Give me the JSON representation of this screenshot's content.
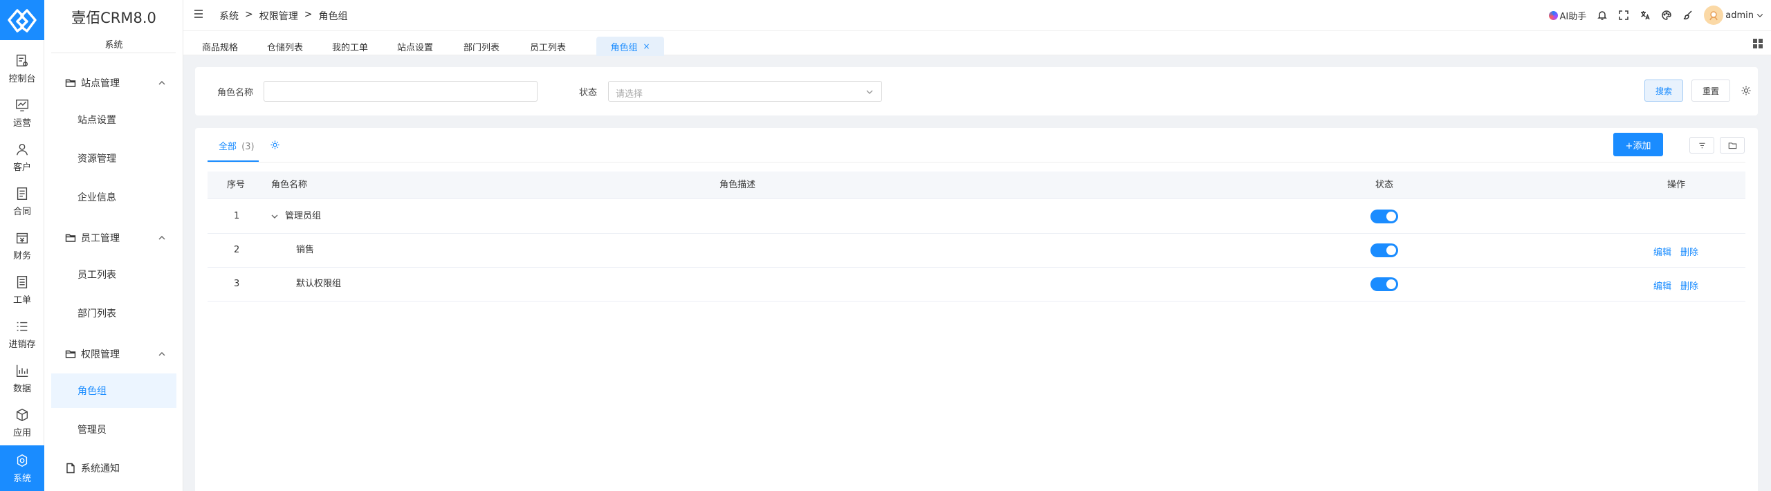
{
  "nav": [
    {
      "label": "控制台",
      "icon": "dashboard-icon"
    },
    {
      "label": "运营",
      "icon": "chart-icon"
    },
    {
      "label": "客户",
      "icon": "user-icon"
    },
    {
      "label": "合同",
      "icon": "contract-icon"
    },
    {
      "label": "财务",
      "icon": "finance-icon"
    },
    {
      "label": "工单",
      "icon": "ticket-icon"
    },
    {
      "label": "进销存",
      "icon": "list-icon"
    },
    {
      "label": "数据",
      "icon": "bar-chart-icon"
    },
    {
      "label": "应用",
      "icon": "box-icon"
    },
    {
      "label": "系统",
      "icon": "system-icon"
    }
  ],
  "menu": {
    "brand": "壹佰CRM8.0",
    "section": "系统",
    "groups": [
      {
        "label": "站点管理",
        "items": [
          "站点设置",
          "资源管理",
          "企业信息"
        ]
      },
      {
        "label": "员工管理",
        "items": [
          "员工列表",
          "部门列表"
        ]
      },
      {
        "label": "权限管理",
        "items": [
          "角色组",
          "管理员"
        ]
      }
    ],
    "notice": "系统通知"
  },
  "breadcrumb": [
    "系统",
    ">",
    "权限管理",
    ">",
    "角色组"
  ],
  "topbar": {
    "ai_label": "AI助手",
    "user": "admin"
  },
  "tabs": [
    {
      "label": "商品规格"
    },
    {
      "label": "仓储列表"
    },
    {
      "label": "我的工单"
    },
    {
      "label": "站点设置"
    },
    {
      "label": "部门列表"
    },
    {
      "label": "员工列表"
    },
    {
      "label": "角色组",
      "close": "×"
    }
  ],
  "search": {
    "name_label": "角色名称",
    "name_value": "",
    "status_label": "状态",
    "status_placeholder": "请选择",
    "search_btn": "搜索",
    "reset_btn": "重置"
  },
  "list": {
    "tab_label": "全部",
    "tab_count": "(3)",
    "add_btn": "+添加",
    "columns": [
      "序号",
      "角色名称",
      "角色描述",
      "状态",
      "操作"
    ],
    "rows": [
      {
        "index": "1",
        "name": "管理员组",
        "desc": "",
        "enabled": true,
        "actions": []
      },
      {
        "index": "2",
        "name": "销售",
        "desc": "",
        "enabled": true,
        "actions": [
          "编辑",
          "删除"
        ]
      },
      {
        "index": "3",
        "name": "默认权限组",
        "desc": "",
        "enabled": true,
        "actions": [
          "编辑",
          "删除"
        ]
      }
    ]
  },
  "colors": {
    "accent": "#1a8cff",
    "active_bg": "#ecf5ff"
  }
}
